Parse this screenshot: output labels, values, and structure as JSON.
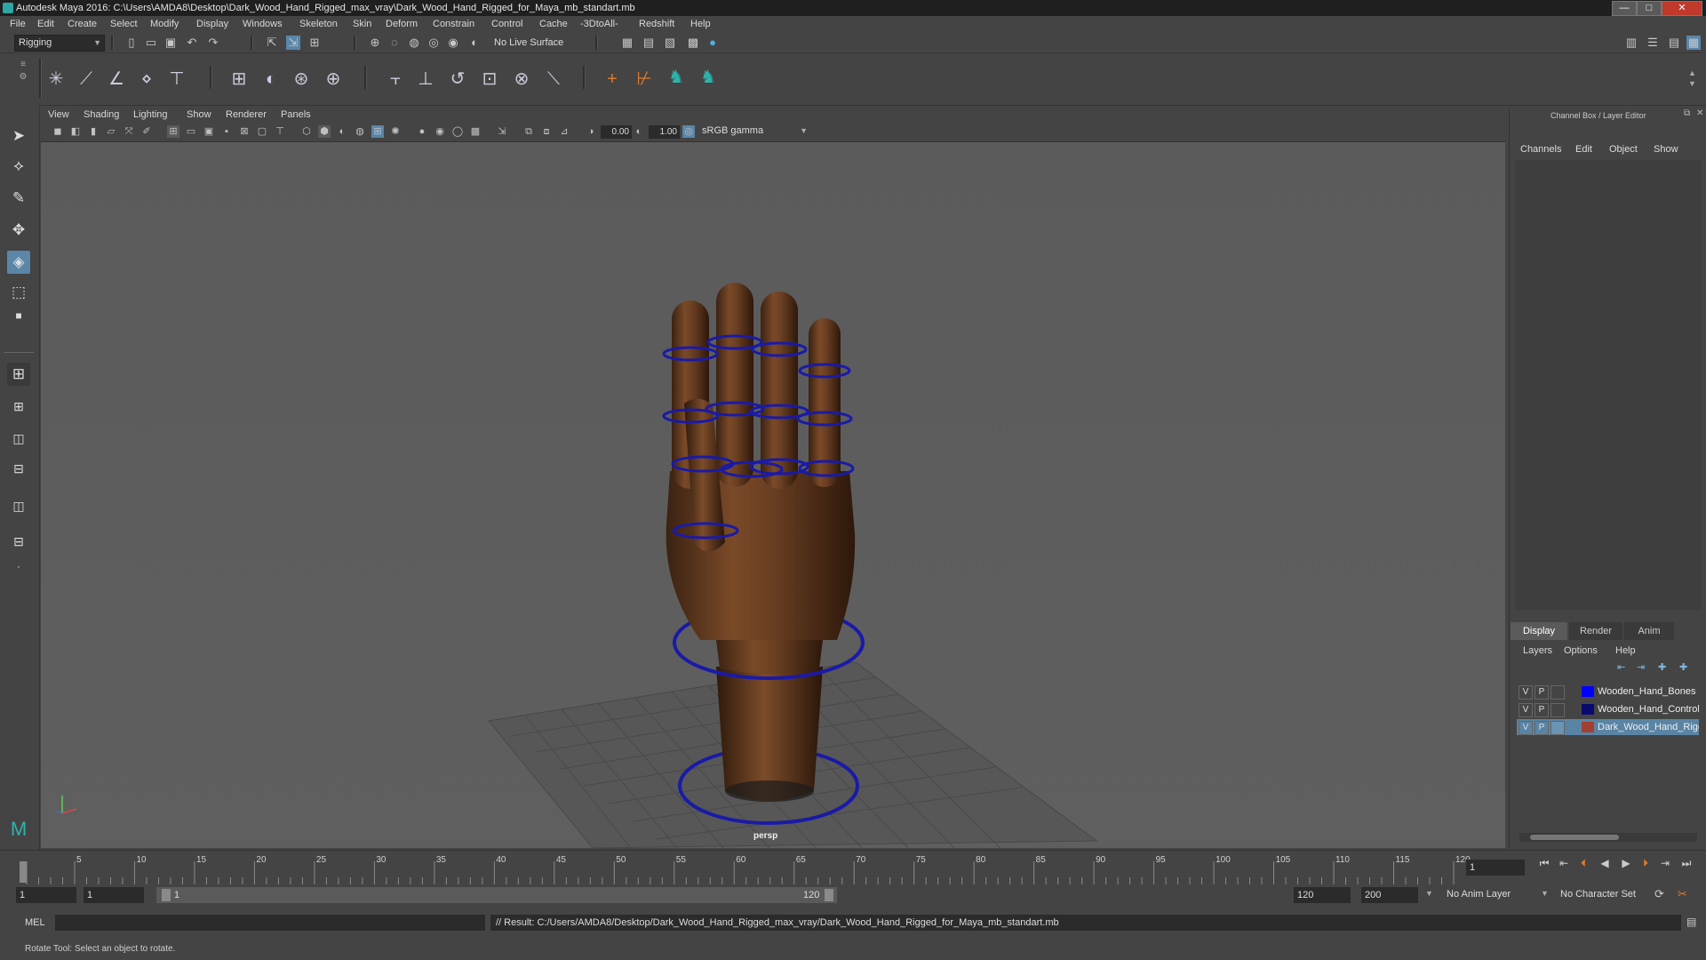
{
  "window": {
    "title": "Autodesk Maya 2016: C:\\Users\\AMDA8\\Desktop\\Dark_Wood_Hand_Rigged_max_vray\\Dark_Wood_Hand_Rigged_for_Maya_mb_standart.mb",
    "minimize": "—",
    "maximize": "□",
    "close": "✕"
  },
  "menubar": [
    "File",
    "Edit",
    "Create",
    "Select",
    "Modify",
    "Display",
    "Windows",
    "Skeleton",
    "Skin",
    "Deform",
    "Constrain",
    "Control",
    "Cache",
    "-3DtoAll-",
    "Redshift",
    "Help"
  ],
  "toolbar": {
    "menuset": "Rigging",
    "live_surface": "No Live Surface"
  },
  "toolbox_icons": [
    "select-tool-icon",
    "lasso-tool-icon",
    "paint-select-icon",
    "move-tool-icon",
    "rotate-tool-icon",
    "scale-tool-icon",
    "last-tool-icon"
  ],
  "viewport": {
    "menus": [
      "View",
      "Shading",
      "Lighting",
      "Show",
      "Renderer",
      "Panels"
    ],
    "exposure": "0.00",
    "gamma": "1.00",
    "colorspace": "sRGB gamma",
    "camera_label": "persp"
  },
  "channel_box": {
    "header": "Channel Box / Layer Editor",
    "tabs": [
      "Channels",
      "Edit",
      "Object",
      "Show"
    ]
  },
  "layer_editor": {
    "tabs": [
      "Display",
      "Render",
      "Anim"
    ],
    "menus": [
      "Layers",
      "Options",
      "Help"
    ],
    "layers": [
      {
        "v": "V",
        "p": "P",
        "name": "Wooden_Hand_Bones",
        "color": "#0000ff",
        "selected": false
      },
      {
        "v": "V",
        "p": "P",
        "name": "Wooden_Hand_Controllers",
        "color": "#0a0a6e",
        "selected": false
      },
      {
        "v": "V",
        "p": "P",
        "name": "Dark_Wood_Hand_Rigged",
        "color": "#a04030",
        "selected": true
      }
    ]
  },
  "timeline": {
    "ticks": [
      "1",
      "5",
      "10",
      "15",
      "20",
      "25",
      "30",
      "35",
      "40",
      "45",
      "50",
      "55",
      "60",
      "65",
      "70",
      "75",
      "80",
      "85",
      "90",
      "95",
      "100",
      "105",
      "110",
      "115",
      "120"
    ],
    "current_frame": "1"
  },
  "range": {
    "start": "1",
    "playback_start": "1",
    "slider_start": "1",
    "slider_end": "120",
    "playback_end": "120",
    "end": "200",
    "anim_layer": "No Anim Layer",
    "character_set": "No Character Set"
  },
  "command": {
    "mode": "MEL",
    "result": "// Result: C:/Users/AMDA8/Desktop/Dark_Wood_Hand_Rigged_max_vray/Dark_Wood_Hand_Rigged_for_Maya_mb_standart.mb"
  },
  "helpline": "Rotate Tool: Select an object to rotate."
}
